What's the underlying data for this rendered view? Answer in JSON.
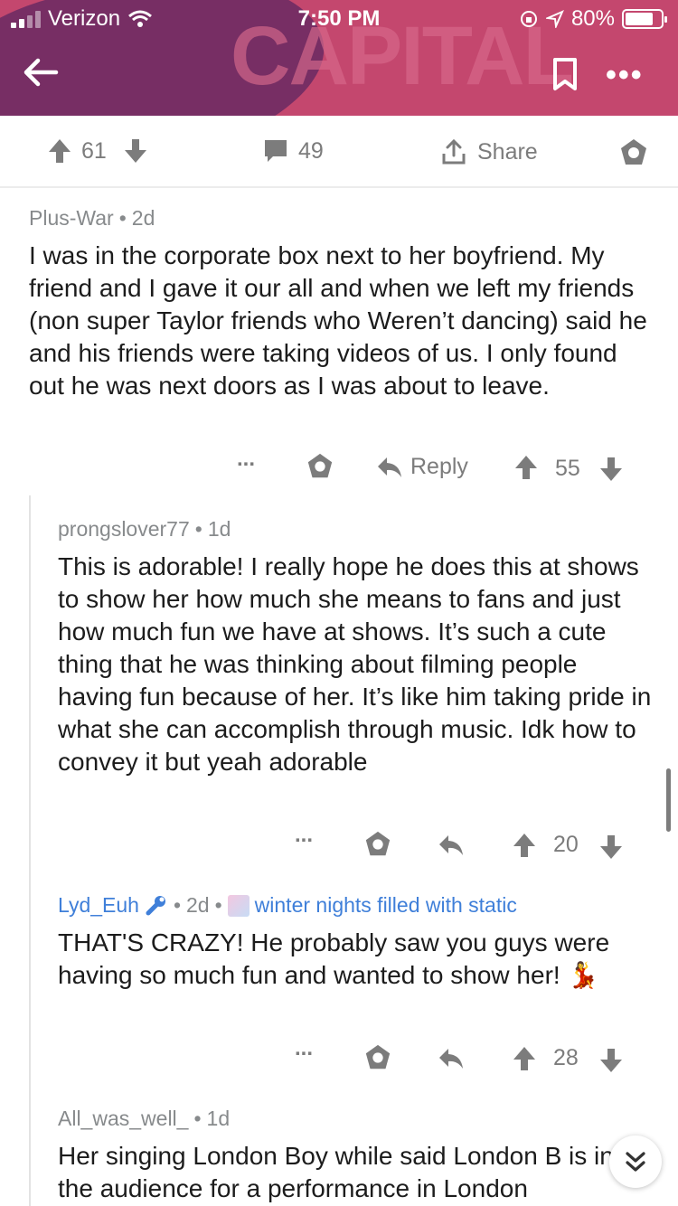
{
  "status": {
    "carrier": "Verizon",
    "time": "7:50 PM",
    "battery": "80%"
  },
  "header": {
    "background_brand": "CAPITAL"
  },
  "post_actions": {
    "upvotes": "61",
    "comments": "49",
    "share_label": "Share"
  },
  "comments": [
    {
      "user": "Plus-War",
      "age": "2d",
      "text": "I was in the corporate box next to her boyfriend. My friend and I gave it our all and when we left my friends (non super Taylor friends who Weren’t dancing) said he and his friends were taking videos of us. I only found out he was next doors as I was about to leave.",
      "reply_label": "Reply",
      "score": "55",
      "more": "..."
    },
    {
      "user": "prongslover77",
      "age": "1d",
      "text": "This is adorable! I really hope he does this at shows to show her how much she means to fans and just how much fun we have at shows. It’s such a cute thing that he was thinking about filming people having fun because of her. It’s like him taking pride in what she can accomplish through music. Idk how to convey it but yeah adorable",
      "score": "20",
      "more": "..."
    },
    {
      "user": "Lyd_Euh",
      "age": "2d",
      "flair": "winter nights filled with static",
      "text": "THAT'S CRAZY! He probably saw you guys were having so much fun and wanted to show her!",
      "emoji": "💃",
      "score": "28",
      "more": "..."
    },
    {
      "user": "All_was_well_",
      "age": "1d",
      "text": "Her singing London Boy while said London B is in the audience for a performance in London"
    }
  ],
  "separator": "•",
  "colors": {
    "header_bg": "#c4476e",
    "accent_blue": "#3f7fd9",
    "meta_gray": "#878a8c"
  }
}
